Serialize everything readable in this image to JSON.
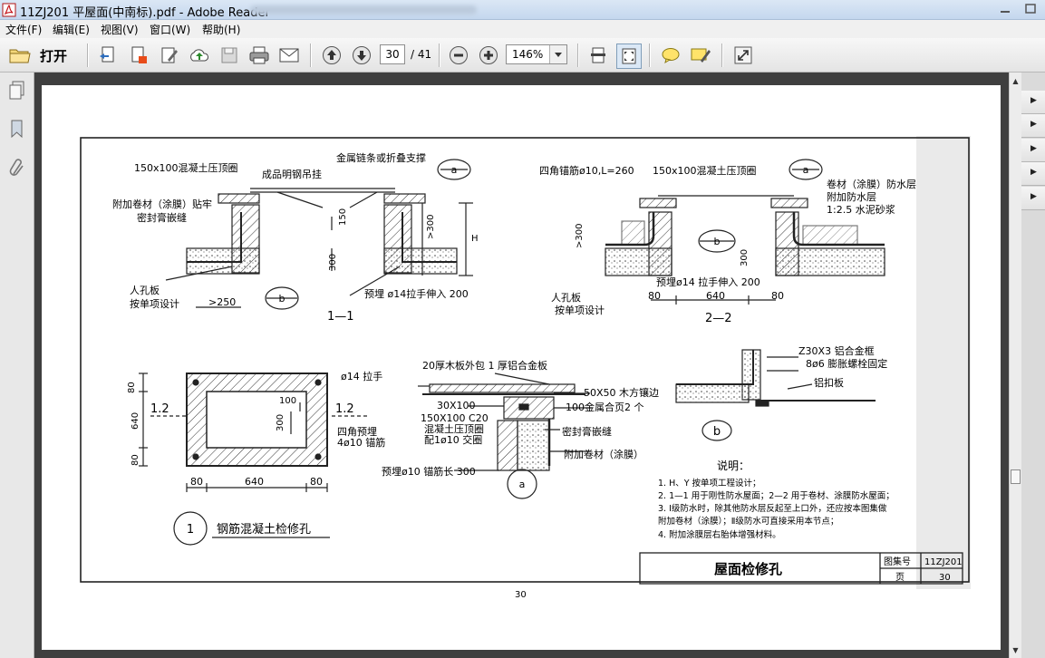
{
  "window": {
    "title": "11ZJ201 平屋面(中南标).pdf - Adobe Reader"
  },
  "menu": [
    {
      "label": "文件(F)"
    },
    {
      "label": "编辑(E)"
    },
    {
      "label": "视图(V)"
    },
    {
      "label": "窗口(W)"
    },
    {
      "label": "帮助(H)"
    }
  ],
  "toolbar": {
    "open_label": "打开",
    "page_current": "30",
    "page_total": "/ 41",
    "zoom": "146%"
  },
  "drawing": {
    "callout_a": "a",
    "callout_b": "b",
    "sec11": {
      "t_concrete_ring": "150x100混凝土压顶圈",
      "t_chain": "金属链条或折叠支撑",
      "t_hinge": "成品明钢吊挂",
      "t_membrane": "附加卷材（涂膜）贴牢",
      "t_sealant": "密封膏嵌缝",
      "dim_150": "150",
      "dim_gt300": ">300",
      "dim_h": "H",
      "dim_300": "300",
      "t_hatch_cover": "人孔板",
      "t_per_project": "按单项设计",
      "dim_gt250": ">250",
      "t_pull_bar": "预埋 ø14拉手伸入 200",
      "section_label": "1—1"
    },
    "sec22": {
      "t_anchor": "四角锚筋ø10,L=260",
      "t_concrete_ring": "150x100混凝土压顶圈",
      "t_waterproof": "卷材（涂膜）防水层",
      "t_extra_layer": "附加防水层",
      "t_mortar": "1:2.5 水泥砂浆",
      "dim_gt300": ">300",
      "dim_300": "300",
      "t_pull_bar": "预埋ø14 拉手伸入 200",
      "t_hatch_cover": "人孔板",
      "t_per_project": "按单项设计",
      "dim_80a": "80",
      "dim_640": "640",
      "dim_80b": "80",
      "section_label": "2—2"
    },
    "plan": {
      "dim_80_top": "80",
      "dim_640": "640",
      "dim_80_bottom": "80",
      "cut_left": "1.2",
      "cut_right": "1.2",
      "t_handle": "ø14 拉手",
      "dim_100": "100",
      "dim_300": "300",
      "t_corner_embed": "四角预埋",
      "t_anchor": "4ø10 锚筋",
      "dim_80_left": "80",
      "dim_640_h": "640",
      "dim_80_right": "80",
      "title_no": "1",
      "title": "钢筋混凝土检修孔"
    },
    "detail_a": {
      "t_wood_board": "20厚木板外包 1 厚铝合金板",
      "t_30x100": "30X100",
      "t_wood_strip": "50X50 木方镶边",
      "t_hinge": "100金属合页2 个",
      "t_ring": "150X100 C20",
      "t_ring2": "混凝土压顶圈",
      "t_rebar": "配1ø10 交圈",
      "t_sealant": "密封膏嵌缝",
      "t_membrane": "附加卷材（涂膜）",
      "t_anchor": "预埋ø10 锚筋长 300"
    },
    "detail_b": {
      "t_frame": "Z30X3 铝合金框",
      "t_bolt": "8ø6 膨胀螺栓固定",
      "t_plate": "铝扣板"
    },
    "notes": {
      "heading": "说明：",
      "items": [
        "1.  H、Y  按单项工程设计；",
        "2.  1—1 用于刚性防水屋面；2—2 用于卷材、涂膜防水屋面；",
        "3.  Ⅰ级防水时，除其他防水层反起至上口外，还应按本图集做",
        "     附加卷材（涂膜）；Ⅱ级防水可直接采用本节点；",
        "4.  附加涂膜层右胎体增强材料。"
      ]
    },
    "titleblock": {
      "title": "屋面检修孔",
      "atlas_label": "图集号",
      "atlas_no": "11ZJ201",
      "page_label": "页",
      "page_no": "30"
    },
    "footer_page": "30"
  }
}
